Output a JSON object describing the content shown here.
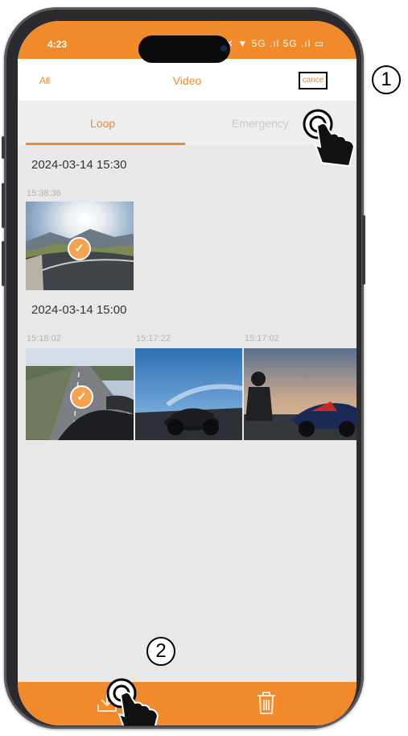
{
  "status_bar": {
    "time": "4:23",
    "icons_text": "✹ ✕ ▼ 5G .ıl 5G .ıl ▭"
  },
  "nav": {
    "left_label": "All",
    "title": "Video",
    "right_label": "cance"
  },
  "tabs": [
    {
      "label": "Loop",
      "active": true
    },
    {
      "label": "Emergency",
      "active": false
    }
  ],
  "groups": [
    {
      "date": "2024-03-14 15:30",
      "items": [
        {
          "time": "15:38:36",
          "selected": true,
          "scene": "mountain-road-sunset"
        }
      ]
    },
    {
      "date": "2024-03-14 15:00",
      "items": [
        {
          "time": "15:18:02",
          "selected": true,
          "scene": "pov-motorcycle-road"
        },
        {
          "time": "15:17:22",
          "selected": false,
          "scene": "motorcycle-blue-sky"
        },
        {
          "time": "15:17:02",
          "selected": false,
          "scene": "rider-sunset"
        }
      ]
    }
  ],
  "bottom_bar": {
    "left_icon": "download-icon",
    "right_icon": "trash-icon"
  },
  "callouts": {
    "step1": "1",
    "step2": "2"
  },
  "colors": {
    "accent": "#f08a2a",
    "background": "#e8e8e8",
    "check": "#f6a24e"
  }
}
